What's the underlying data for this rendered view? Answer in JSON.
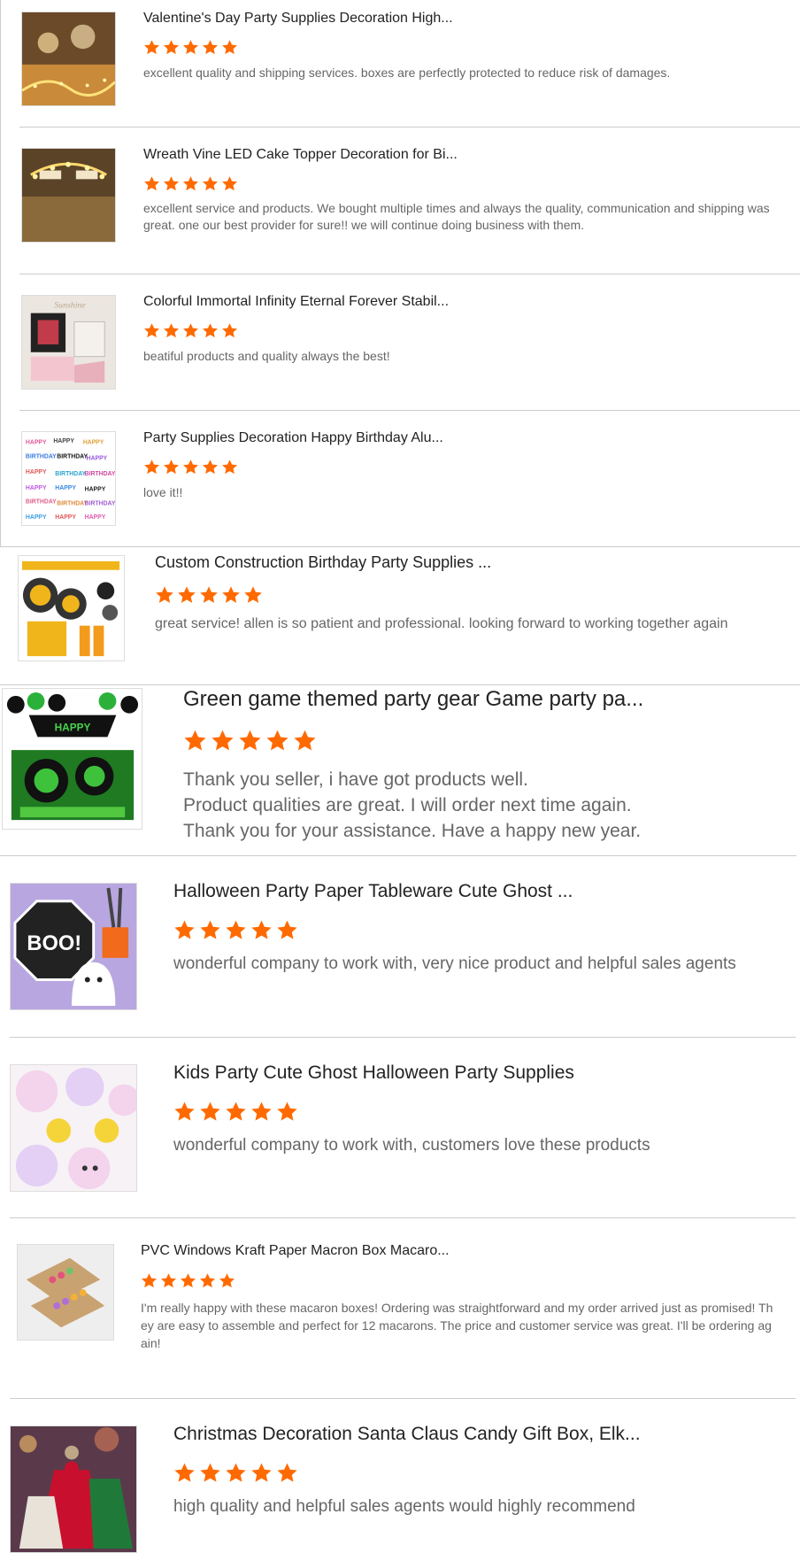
{
  "colors": {
    "star": "#ff6a00",
    "divider": "#cccccc"
  },
  "reviews": [
    {
      "title": "Valentine's Day Party Supplies Decoration High...",
      "rating": 5,
      "text": "excellent quality and shipping services. boxes are perfectly protected to reduce risk of damages.",
      "image": "valentine-fairy-lights-photo"
    },
    {
      "title": "Wreath Vine LED Cake Topper Decoration for Bi...",
      "rating": 5,
      "text": "excellent service and products. We bought multiple times and always the quality, communication and shipping was great. one our best provider for sure!! we will continue doing business with them.",
      "image": "led-cake-topper-photo"
    },
    {
      "title": "Colorful Immortal Infinity Eternal Forever Stabil...",
      "rating": 5,
      "text": "beatiful products and quality always the best!",
      "image": "gift-box-photo"
    },
    {
      "title": "Party Supplies Decoration Happy Birthday Alu...",
      "rating": 5,
      "text": "love it!!",
      "image": "happy-birthday-balloons-photo"
    },
    {
      "title": "Custom Construction Birthday Party Supplies ...",
      "rating": 5,
      "text": "great service! allen is so patient and professional. looking forward to working together again",
      "image": "construction-party-photo"
    },
    {
      "title": "Green game themed party gear Game party pa...",
      "rating": 5,
      "text": "Thank you seller, i have got products well.\nProduct qualities are great. I will order next time again.\nThank you for your assistance. Have a happy new year.",
      "image": "green-game-party-photo"
    },
    {
      "title": "Halloween Party Paper Tableware Cute Ghost ...",
      "rating": 5,
      "text": "wonderful company to work with, very nice product and helpful sales agents",
      "image": "boo-ghost-tableware-photo",
      "img_text": "BOO!"
    },
    {
      "title": "Kids Party Cute Ghost Halloween Party Supplies",
      "rating": 5,
      "text": "wonderful company to work with, customers love these products",
      "image": "ghost-plates-photo"
    },
    {
      "title": "PVC Windows Kraft Paper Macron Box Macaro...",
      "rating": 5,
      "text": "I'm really happy with these macaron boxes! Ordering was straightforward and my order arrived just as promised! They are easy to assemble and perfect for 12 macarons. The price and customer service was great. I'll be ordering again!",
      "image": "macaron-box-photo"
    },
    {
      "title": "Christmas Decoration Santa Claus Candy Gift Box, Elk...",
      "rating": 5,
      "text": "high quality and helpful sales agents would highly recommend",
      "image": "christmas-candy-box-photo"
    }
  ]
}
